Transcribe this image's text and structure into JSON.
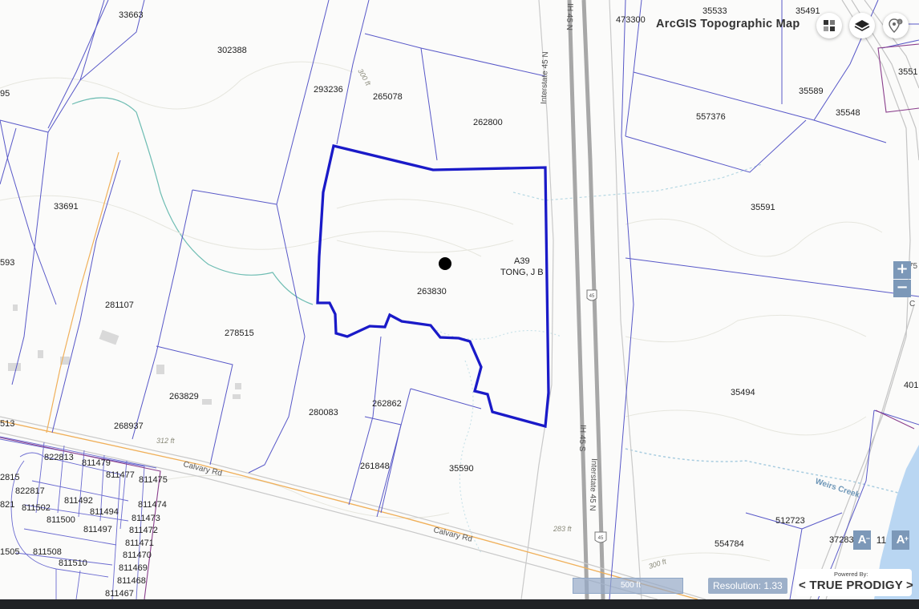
{
  "map": {
    "basemap_title": "ArcGIS Topographic Map",
    "parcels": [
      {
        "id": "p1",
        "label": "33663"
      },
      {
        "id": "p2",
        "label": "302388"
      },
      {
        "id": "p3",
        "label": "293236"
      },
      {
        "id": "p4",
        "label": "265078"
      },
      {
        "id": "p5",
        "label": "262800"
      },
      {
        "id": "p6",
        "label": "473300"
      },
      {
        "id": "p7",
        "label": "35533"
      },
      {
        "id": "p8",
        "label": "35491"
      },
      {
        "id": "p9",
        "label": "3551"
      },
      {
        "id": "p10",
        "label": "95"
      },
      {
        "id": "p11",
        "label": "35589"
      },
      {
        "id": "p12",
        "label": "557376"
      },
      {
        "id": "p13",
        "label": "35548"
      },
      {
        "id": "p14",
        "label": "33691"
      },
      {
        "id": "p15",
        "label": "35591"
      },
      {
        "id": "p16",
        "label": "593"
      },
      {
        "id": "p17",
        "label": "263830"
      },
      {
        "id": "p18",
        "label": "281107"
      },
      {
        "id": "p19",
        "label": "278515"
      },
      {
        "id": "p20",
        "label": "35494"
      },
      {
        "id": "p21",
        "label": "401"
      },
      {
        "id": "p22",
        "label": "263829"
      },
      {
        "id": "p23",
        "label": "280083"
      },
      {
        "id": "p24",
        "label": "262862"
      },
      {
        "id": "p25",
        "label": "268937"
      },
      {
        "id": "p26",
        "label": "513"
      },
      {
        "id": "p27",
        "label": "822813"
      },
      {
        "id": "p28",
        "label": "811479"
      },
      {
        "id": "p29",
        "label": "811477"
      },
      {
        "id": "p30",
        "label": "811475"
      },
      {
        "id": "p31",
        "label": "2815"
      },
      {
        "id": "p32",
        "label": "822817"
      },
      {
        "id": "p33",
        "label": "261848"
      },
      {
        "id": "p34",
        "label": "35590"
      },
      {
        "id": "p35",
        "label": "821"
      },
      {
        "id": "p36",
        "label": "811492"
      },
      {
        "id": "p37",
        "label": "811502"
      },
      {
        "id": "p38",
        "label": "811494"
      },
      {
        "id": "p39",
        "label": "811474"
      },
      {
        "id": "p40",
        "label": "811500"
      },
      {
        "id": "p41",
        "label": "811473"
      },
      {
        "id": "p42",
        "label": "811497"
      },
      {
        "id": "p43",
        "label": "811472"
      },
      {
        "id": "p44",
        "label": "811471"
      },
      {
        "id": "p45",
        "label": "512723"
      },
      {
        "id": "p46",
        "label": "1505"
      },
      {
        "id": "p47",
        "label": "811508"
      },
      {
        "id": "p48",
        "label": "811470"
      },
      {
        "id": "p49",
        "label": "37283"
      },
      {
        "id": "p50",
        "label": "554784"
      },
      {
        "id": "p51",
        "label": "811510"
      },
      {
        "id": "p52",
        "label": "811469"
      },
      {
        "id": "p53",
        "label": "811468"
      },
      {
        "id": "p54",
        "label": "811467"
      }
    ],
    "subject": {
      "abstract": "A39",
      "owner": "TONG, J B"
    },
    "roads": {
      "ih45_n": "IH 45 N",
      "interstate_45n_upper": "Interstate 45 N",
      "ih45_s": "IH 45 S",
      "interstate_45n_lower": "Interstate 45 N",
      "calvary_upper": "Calvary Rd",
      "calvary_lower": "Calvary Rd",
      "shield_upper": "45",
      "shield_lower": "45",
      "right_road_short": "C",
      "edge_label": "75"
    },
    "contours": {
      "c1": "300 ft",
      "c2": "312 ft",
      "c3": "283 ft",
      "c4": "300 ft"
    },
    "water": {
      "creek": "Weirs Creek"
    }
  },
  "controls": {
    "basemap_icon": "grid-icon",
    "layers_icon": "layers-icon",
    "locate_icon": "location-pin-icon",
    "zoom_in": "+",
    "zoom_out": "−",
    "text_size_down": "A",
    "text_size_up": "A",
    "text_size_value": "11",
    "scale_label": "500 ft",
    "resolution": "Resolution: 1.33"
  },
  "branding": {
    "powered_by": "Powered By:",
    "brand": "< TRUE PRODIGY >"
  },
  "colors": {
    "parcel_line": "#5858c8",
    "subject_outline": "#1a1ac8",
    "road_gray": "#9a9a9a",
    "accent_blue": "#7c98b8"
  }
}
